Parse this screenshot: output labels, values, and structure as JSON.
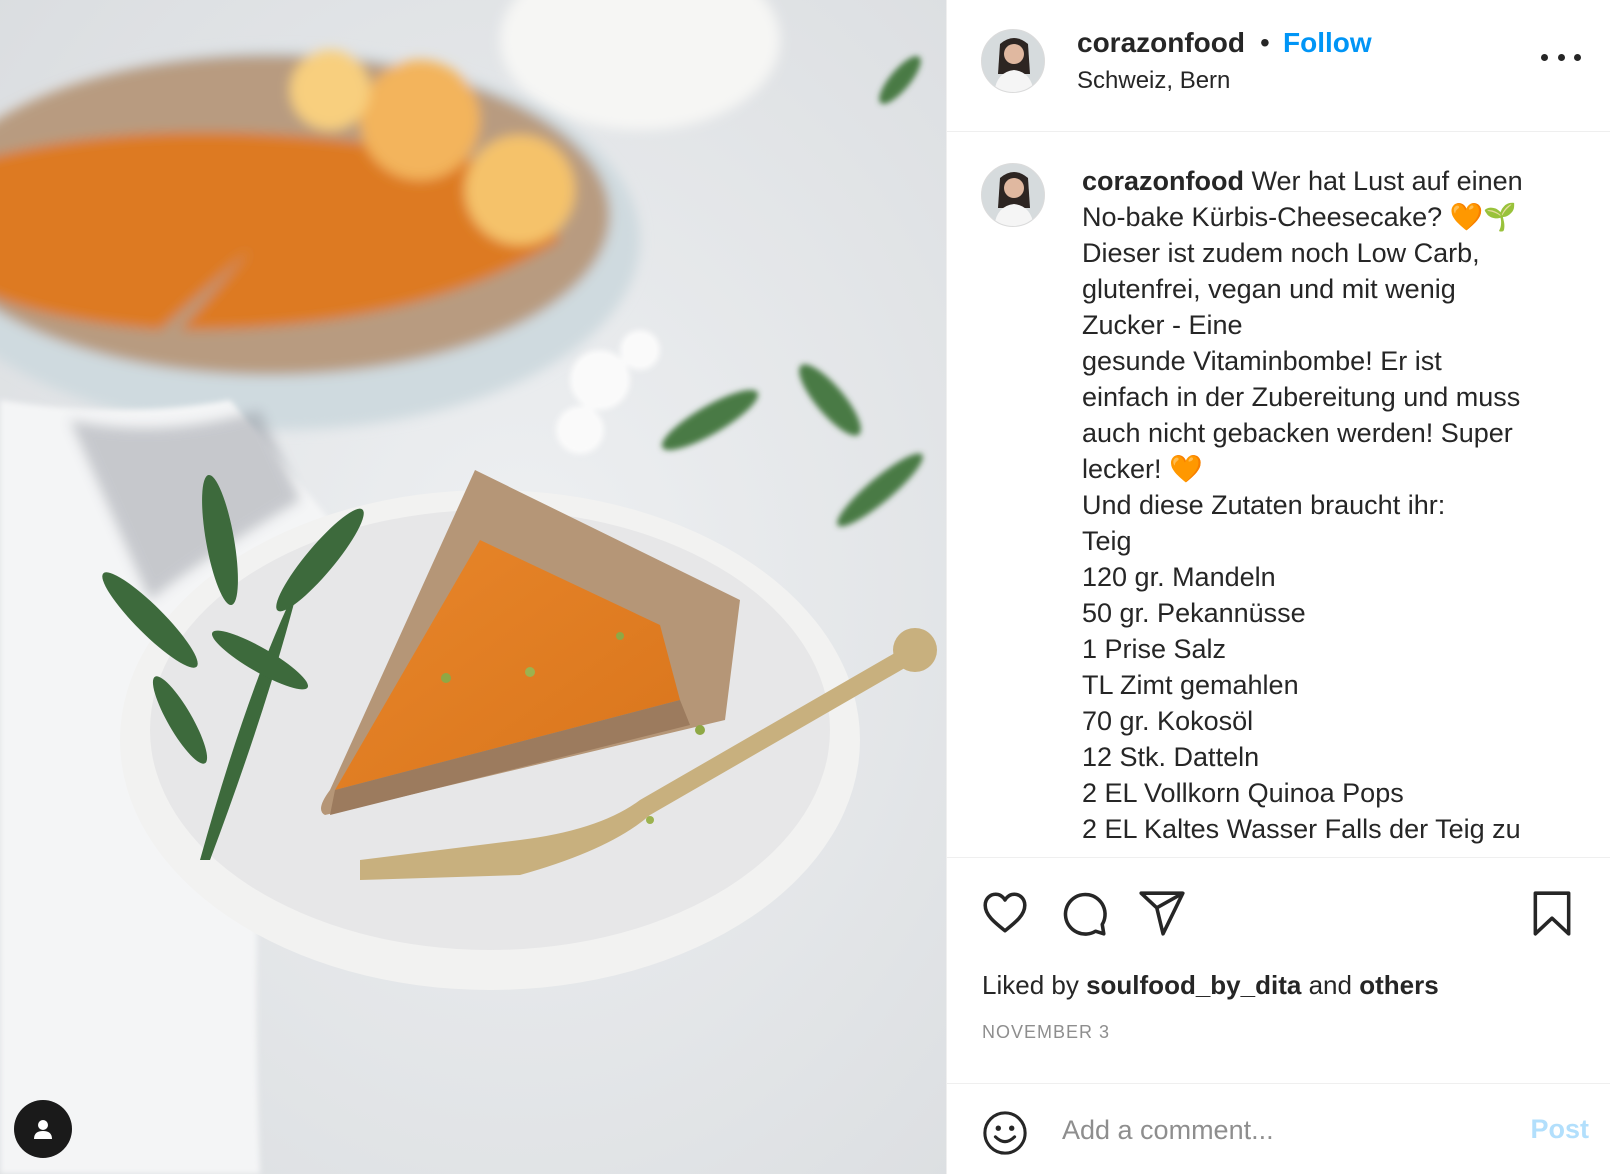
{
  "post": {
    "image_alt": "No-bake pumpkin cheesecake slice on a white plate with a gold fork",
    "username": "corazonfood",
    "follow_label": "Follow",
    "separator": "•",
    "location": "Schweiz, Bern"
  },
  "caption": {
    "username": "corazonfood",
    "lines": [
      "Wer hat Lust auf einen",
      "No-bake Kürbis-Cheesecake? 🧡🌱",
      "Dieser ist zudem noch Low Carb,",
      "glutenfrei, vegan und mit wenig",
      "Zucker - Eine",
      "gesunde Vitaminbombe! Er ist",
      "einfach in der Zubereitung und muss",
      "auch nicht gebacken werden! Super",
      "lecker! 🧡",
      "Und diese Zutaten braucht ihr:",
      "Teig",
      "120 gr. Mandeln",
      "50 gr. Pekannüsse",
      "1 Prise Salz",
      "TL Zimt gemahlen",
      "70 gr. Kokosöl",
      "12 Stk. Datteln",
      "2 EL Vollkorn Quinoa Pops",
      "2 EL Kaltes Wasser Falls der Teig zu"
    ]
  },
  "actions": {
    "icons": [
      "heart-icon",
      "comment-icon",
      "share-icon",
      "bookmark-icon"
    ]
  },
  "likes": {
    "prefix": "Liked by",
    "user": "soulfood_by_dita",
    "middle": "and",
    "others": "others"
  },
  "date": "NOVEMBER 3",
  "comment": {
    "placeholder": "Add a comment...",
    "post_label": "Post"
  },
  "colors": {
    "accent": "#0095f6",
    "post_disabled": "#b2dffc",
    "text": "#262626",
    "muted": "#8e8e8e",
    "border": "#efefef"
  }
}
